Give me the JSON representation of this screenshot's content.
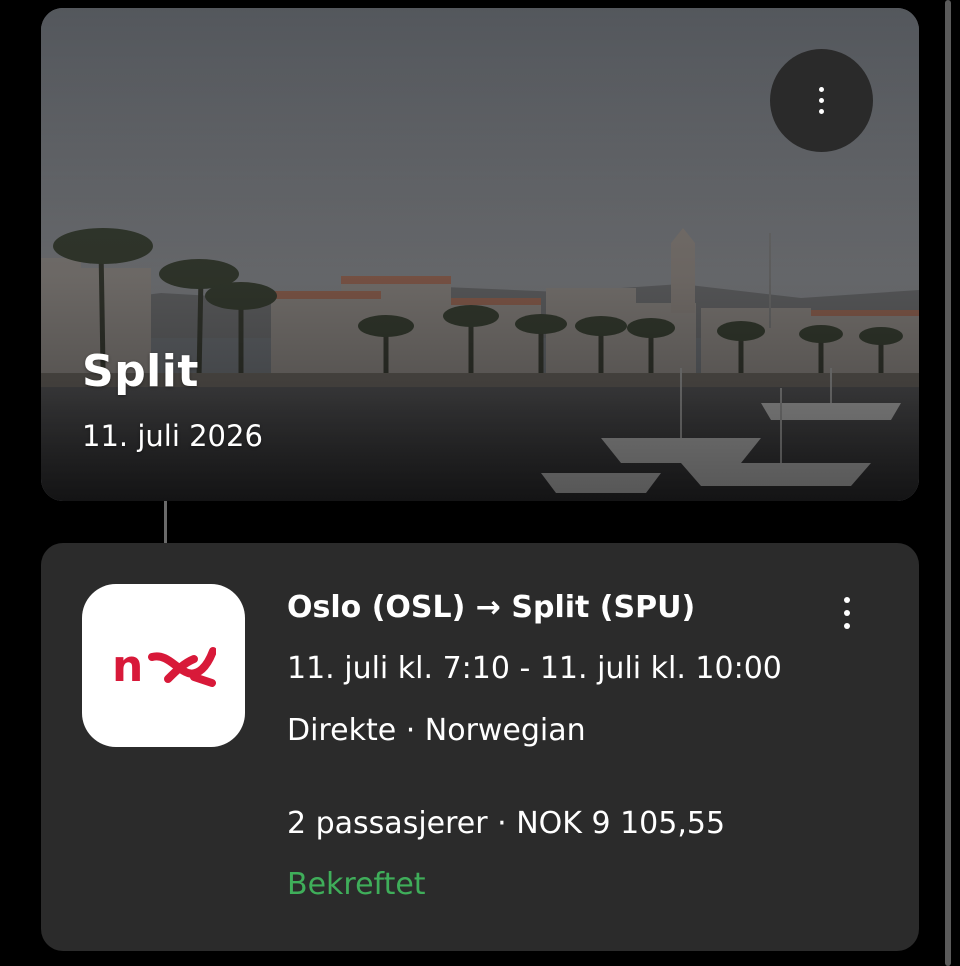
{
  "destination": {
    "city": "Split",
    "date": "11. juli 2026"
  },
  "flight": {
    "airline_logo_text": "nx",
    "route": "Oslo (OSL) → Split (SPU)",
    "times": "11. juli kl. 7:10 - 11. juli kl. 10:00",
    "details": "Direkte · Norwegian",
    "passengers_price": "2 passasjerer · NOK 9 105,55",
    "status": "Bekreftet"
  },
  "icons": {
    "hero_menu": "more-vertical-icon",
    "flight_menu": "more-vertical-icon"
  },
  "colors": {
    "background": "#000000",
    "card": "#2b2b2b",
    "status_green": "#3fae5a",
    "brand_red": "#d81939"
  }
}
